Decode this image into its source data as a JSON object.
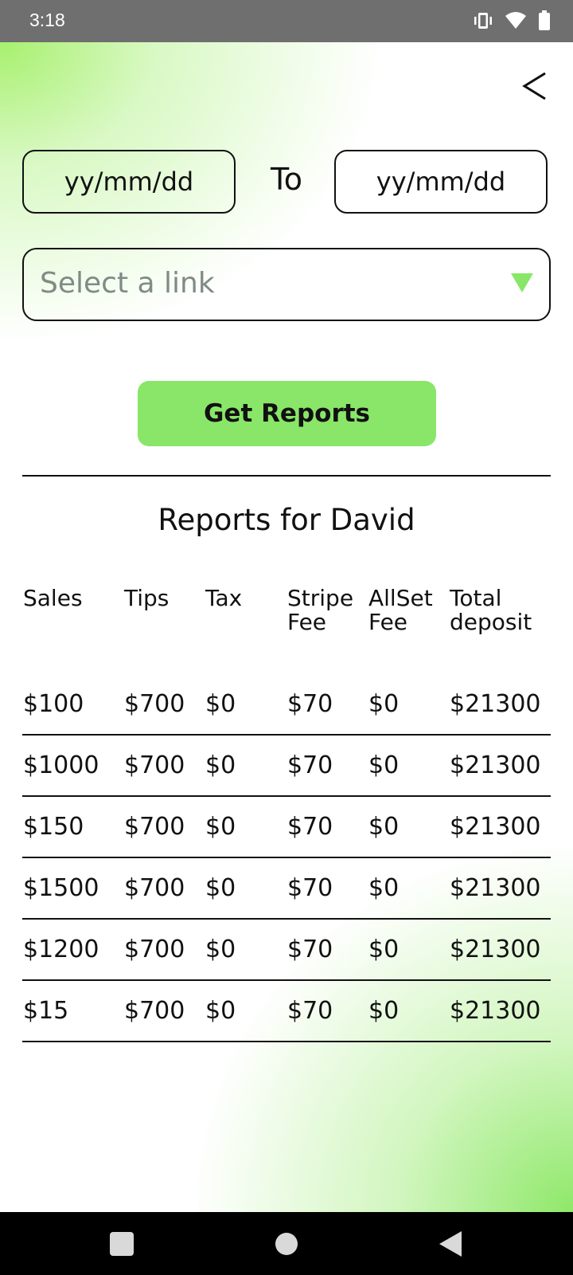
{
  "status_bar": {
    "time": "3:18"
  },
  "header": {
    "back_icon": "chevron-left-icon"
  },
  "date_range": {
    "from_placeholder": "yy/mm/dd",
    "to_label": "To",
    "to_placeholder": "yy/mm/dd"
  },
  "link_select": {
    "placeholder": "Select a link"
  },
  "get_reports_label": "Get Reports",
  "reports_title": "Reports for David",
  "table": {
    "headers": [
      "Sales",
      "Tips",
      "Tax",
      "Stripe Fee",
      "AllSet Fee",
      "Total deposit"
    ],
    "rows": [
      [
        "$100",
        "$700",
        "$0",
        "$70",
        "$0",
        "$21300"
      ],
      [
        "$1000",
        "$700",
        "$0",
        "$70",
        "$0",
        "$21300"
      ],
      [
        "$150",
        "$700",
        "$0",
        "$70",
        "$0",
        "$21300"
      ],
      [
        "$1500",
        "$700",
        "$0",
        "$70",
        "$0",
        "$21300"
      ],
      [
        "$1200",
        "$700",
        "$0",
        "$70",
        "$0",
        "$21300"
      ],
      [
        "$15",
        "$700",
        "$0",
        "$70",
        "$0",
        "$21300"
      ]
    ]
  },
  "colors": {
    "accent": "#89e668",
    "status_bar": "#6f6f6f",
    "nav_bar": "#000000",
    "placeholder": "#7f8b86"
  }
}
